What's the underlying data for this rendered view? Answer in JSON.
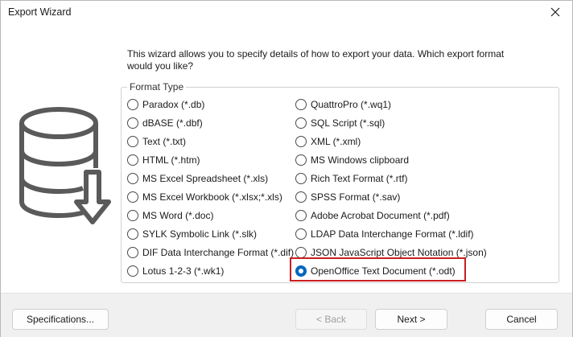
{
  "window": {
    "title": "Export Wizard"
  },
  "intro_text": "This wizard allows you to specify details of how to export your data. Which export format would you like?",
  "format_group": {
    "legend": "Format Type",
    "left_options": [
      "Paradox (*.db)",
      "dBASE (*.dbf)",
      "Text (*.txt)",
      "HTML (*.htm)",
      "MS Excel Spreadsheet (*.xls)",
      "MS Excel Workbook (*.xlsx;*.xls)",
      "MS Word (*.doc)",
      "SYLK Symbolic Link (*.slk)",
      "DIF Data Interchange Format (*.dif)",
      "Lotus 1-2-3 (*.wk1)"
    ],
    "right_options": [
      "QuattroPro (*.wq1)",
      "SQL Script (*.sql)",
      "XML (*.xml)",
      "MS Windows clipboard",
      "Rich Text Format (*.rtf)",
      "SPSS Format (*.sav)",
      "Adobe Acrobat Document (*.pdf)",
      "LDAP Data Interchange Format (*.ldif)",
      "JSON JavaScript Object Notation (*.json)",
      "OpenOffice Text Document (*.odt)"
    ],
    "selected": "OpenOffice Text Document (*.odt)"
  },
  "footer": {
    "specifications_label": "Specifications...",
    "back_label": "< Back",
    "next_label": "Next >",
    "cancel_label": "Cancel"
  },
  "colors": {
    "accent": "#0067c0",
    "highlight_border": "#cc1f1f",
    "footer_bg": "#f0f0f0"
  }
}
